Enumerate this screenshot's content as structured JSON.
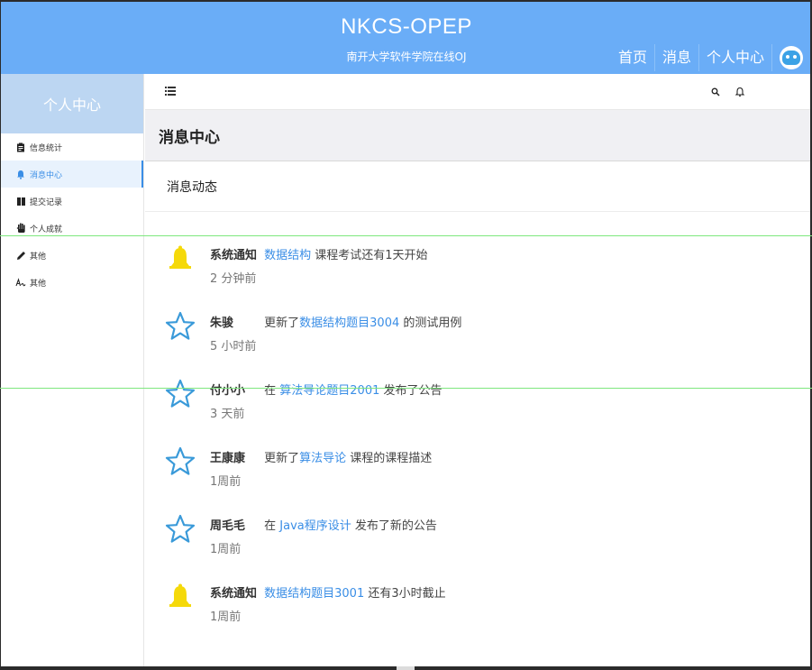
{
  "header": {
    "title": "NKCS-OPEP",
    "subtitle": "南开大学软件学院在线OJ",
    "nav": [
      "首页",
      "消息",
      "个人中心"
    ],
    "brand_color": "#6aadf7"
  },
  "sidebar": {
    "title": "个人中心",
    "items": [
      {
        "label": "信息统计",
        "icon": "clipboard-icon"
      },
      {
        "label": "消息中心",
        "icon": "bell-icon"
      },
      {
        "label": "提交记录",
        "icon": "book-icon"
      },
      {
        "label": "个人成就",
        "icon": "hand-icon"
      },
      {
        "label": "其他",
        "icon": "pencil-icon"
      },
      {
        "label": "其他",
        "icon": "signature-icon"
      }
    ],
    "active_index": 1
  },
  "main": {
    "page_title": "消息中心",
    "section_title": "消息动态",
    "feed": [
      {
        "type": "bell",
        "who": "系统通知",
        "pre": "",
        "link": "数据结构",
        "post": " 课程考试还有1天开始",
        "time": "2 分钟前"
      },
      {
        "type": "star",
        "who": "朱骏",
        "pre": "更新了",
        "link": "数据结构题目3004",
        "post": " 的测试用例",
        "time": "5 小时前"
      },
      {
        "type": "star",
        "who": "付小小",
        "pre": "在 ",
        "link": "算法导论题目2001",
        "post": " 发布了公告",
        "time": "3 天前"
      },
      {
        "type": "star",
        "who": "王康康",
        "pre": "更新了",
        "link": "算法导论",
        "post": " 课程的课程描述",
        "time": "1周前"
      },
      {
        "type": "star",
        "who": "周毛毛",
        "pre": "在 ",
        "link": "Java程序设计",
        "post": " 发布了新的公告",
        "time": "1周前"
      },
      {
        "type": "bell",
        "who": "系统通知",
        "pre": "",
        "link": "数据结构题目3001",
        "post": " 还有3小时截止",
        "time": "1周前"
      }
    ]
  },
  "colors": {
    "accent": "#3a8ee6",
    "bell": "#f5d90a",
    "star": "#3a9ad9"
  }
}
